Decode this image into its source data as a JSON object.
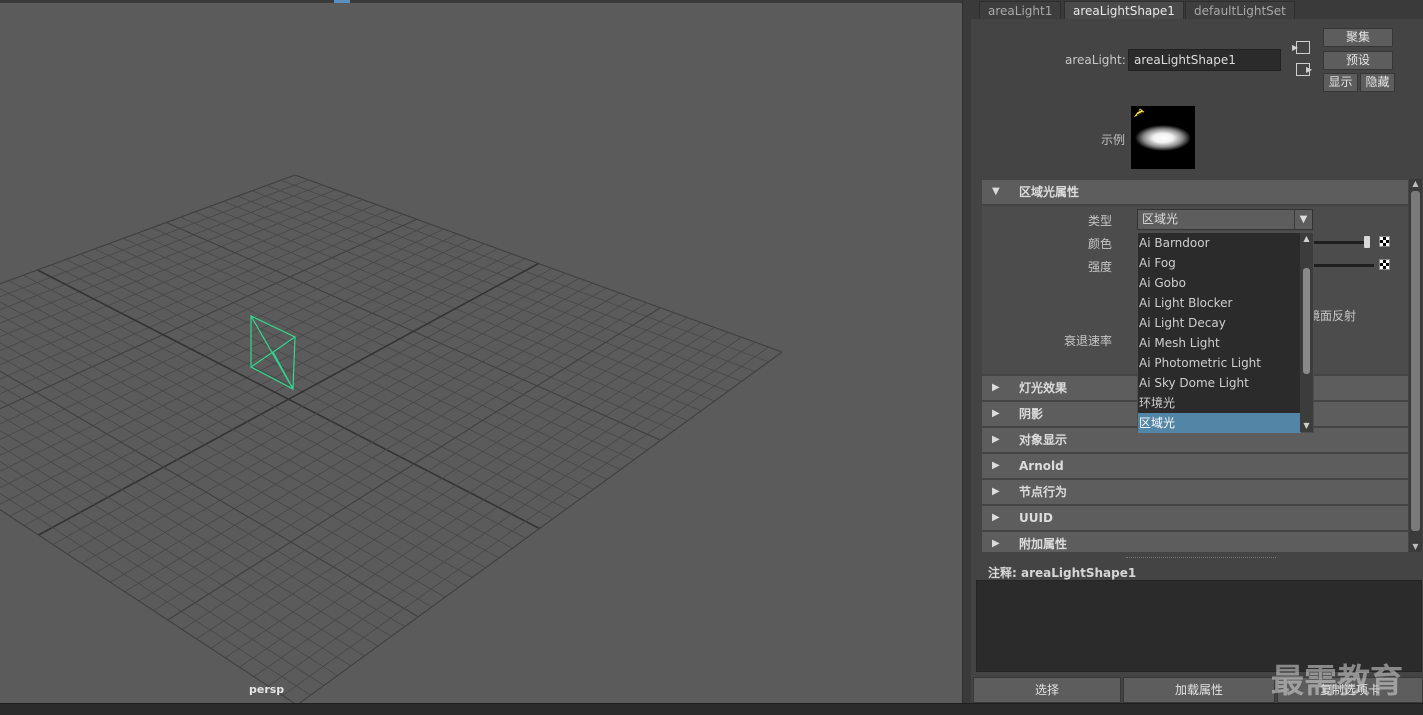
{
  "viewport": {
    "camera_label": "persp"
  },
  "attribute_editor": {
    "tabs": [
      {
        "label": "areaLight1",
        "active": false
      },
      {
        "label": "areaLightShape1",
        "active": true
      },
      {
        "label": "defaultLightSet",
        "active": false
      }
    ],
    "node_type_label": "areaLight:",
    "node_name_value": "areaLightShape1",
    "buttons": {
      "focus": "聚集",
      "presets": "预设",
      "show": "显示",
      "hide": "隐藏"
    },
    "sample_label": "示例",
    "sections": {
      "area_light_attributes": "区域光属性",
      "light_effects": "灯光效果",
      "shadows": "阴影",
      "object_display": "对象显示",
      "arnold": "Arnold",
      "node_behavior": "节点行为",
      "uuid": "UUID",
      "extra_attributes": "附加属性"
    },
    "attributes": {
      "type_label": "类型",
      "type_value": "区域光",
      "color_label": "颜色",
      "intensity_label": "强度",
      "specular_partial": "镜面反射",
      "decay_rate_label": "衰退速率"
    },
    "type_options": [
      "Ai Barndoor",
      "Ai Fog",
      "Ai Gobo",
      "Ai Light Blocker",
      "Ai Light Decay",
      "Ai Mesh Light",
      "Ai Photometric Light",
      "Ai Sky Dome Light",
      "环境光",
      "区域光"
    ],
    "selected_option": "区域光",
    "notes_label": "注释:  areaLightShape1",
    "bottom_buttons": {
      "select": "选择",
      "load_attributes": "加载属性",
      "copy_tab": "复制选项卡"
    }
  },
  "watermark": "最需教育",
  "colors": {
    "viewport_bg": "#5b5b5b",
    "grid_line": "#474747",
    "grid_axis": "#333333",
    "light_outline": "#30d890",
    "selected_item": "#5285a6",
    "panel_bg": "#444444",
    "section_header": "#5d5d5d"
  }
}
